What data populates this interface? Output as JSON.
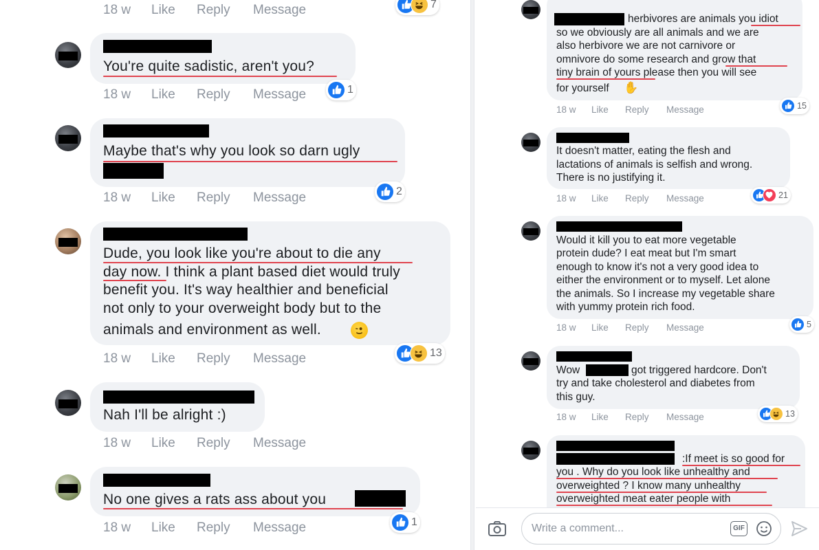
{
  "meta_labels": {
    "time": "18 w",
    "like": "Like",
    "reply": "Reply",
    "message": "Message"
  },
  "left": {
    "top_partial": {
      "reaction_count": "7"
    },
    "comments": [
      {
        "text_lines": [
          "You're quite sadistic, aren't you?"
        ],
        "reaction_count": "1",
        "reactions": [
          "like"
        ]
      },
      {
        "text_lines": [
          "Maybe that's why you look so darn ugly"
        ],
        "reaction_count": "2",
        "reactions": [
          "like"
        ]
      },
      {
        "text_lines": [
          "Dude, you look like you're about to die any",
          "day now. I think a plant based diet would truly",
          "benefit you. It's way healthier and beneficial",
          "not only to your overweight body but to the",
          "animals and environment as well."
        ],
        "reaction_count": "13",
        "reactions": [
          "like",
          "haha"
        ]
      },
      {
        "text_lines": [
          "Nah I'll be alright :)"
        ]
      },
      {
        "text_lines": [
          "No one gives a rats ass about you"
        ],
        "reaction_count": "1",
        "reactions": [
          "like"
        ]
      }
    ]
  },
  "right": {
    "comments": [
      {
        "text_lines": [
          "herbivores are animals you idiot",
          "so we obviously are all animals and we are",
          "also herbivore we are not carnivore or",
          "omnivore do some research and grow that",
          "tiny brain of yours please then you will see",
          "for yourself"
        ],
        "reaction_count": "15",
        "reactions": [
          "like"
        ]
      },
      {
        "text_lines": [
          "It doesn't matter, eating the flesh and",
          "lactations of animals is selfish and wrong.",
          "There is no justifying it."
        ],
        "reaction_count": "21",
        "reactions": [
          "like",
          "love"
        ]
      },
      {
        "text_lines": [
          "Would it kill you to eat more vegetable",
          "protein dude? I eat meat but I'm smart",
          "enough to know it's not a very good idea to",
          "either the environment or to myself. Let alone",
          "the animals. So I increase my vegetable share",
          "with yummy protein rich food."
        ],
        "reaction_count": "5",
        "reactions": [
          "like"
        ]
      },
      {
        "text_lines": [
          "Wow",
          "got triggered hardcore. Don't",
          "try and take cholesterol and diabetes from",
          "this guy."
        ],
        "reaction_count": "13",
        "reactions": [
          "like",
          "haha"
        ]
      },
      {
        "text_lines": [
          ":If meet is so good for",
          "you . Why do you look like unhealthy and",
          "overweighted ? I know many unhealthy",
          "overweighted meat eater people with"
        ]
      }
    ],
    "composer": {
      "placeholder": "Write a comment...",
      "gif_label": "GIF"
    }
  },
  "colors": {
    "like_blue": "#1877f2",
    "love_red": "#f33e58",
    "underline_red": "#e0434e",
    "bubble_bg": "#f0f2f5",
    "meta_gray": "#8d949e"
  },
  "icons": [
    "like-icon",
    "haha-icon",
    "love-icon",
    "wink-emoji-icon",
    "raised-hand-emoji-icon",
    "camera-icon",
    "gif-icon",
    "smiley-icon",
    "send-icon"
  ]
}
